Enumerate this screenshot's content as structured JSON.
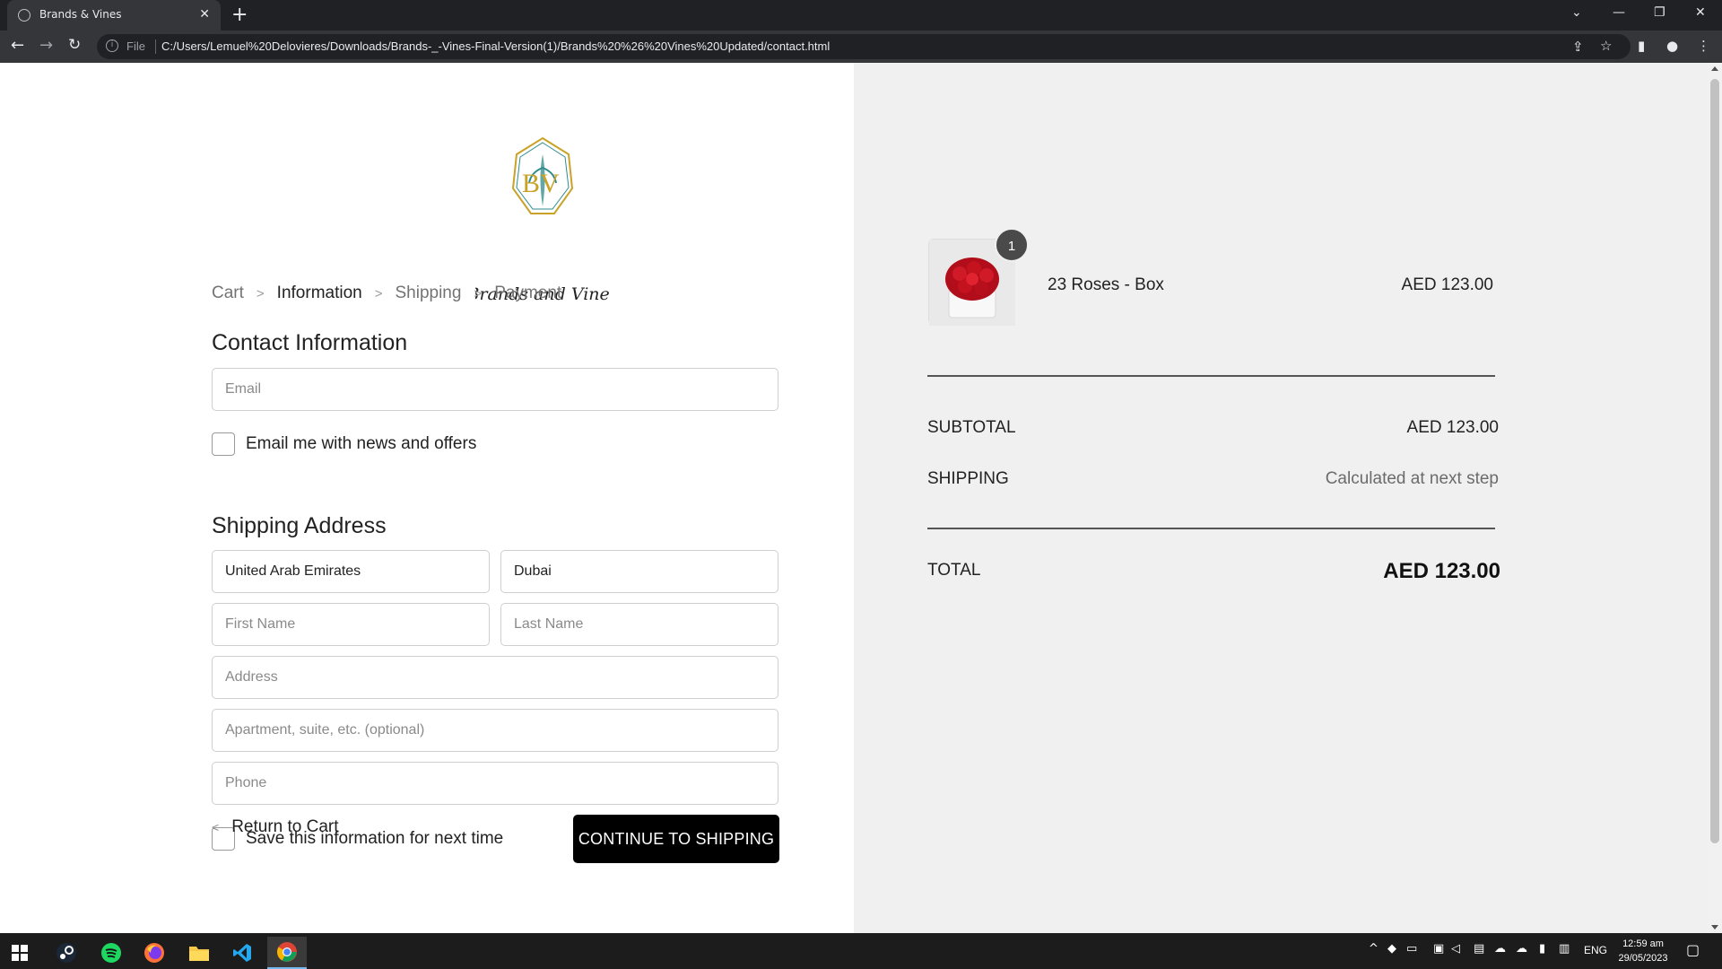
{
  "browser": {
    "tab_title": "Brands & Vines",
    "tab_close": "✕",
    "new_tab": "+",
    "omnibox_scheme": "File",
    "url": "C:/Users/Lemuel%20Delovieres/Downloads/Brands-_-Vines-Final-Version(1)/Brands%20%26%20Vines%20Updated/contact.html"
  },
  "logo": {
    "monogram": "BV",
    "script": "Brands and Vines"
  },
  "breadcrumb": {
    "cart": "Cart",
    "information": "Information",
    "shipping": "Shipping",
    "payment": "Payment",
    "separator": ">"
  },
  "contact": {
    "title": "Contact Information",
    "email_placeholder": "Email",
    "newsletter_label": "Email me with news and offers"
  },
  "shipping_address": {
    "title": "Shipping Address",
    "country_value": "United Arab Emirates",
    "city_value": "Dubai",
    "first_name_placeholder": "First Name",
    "last_name_placeholder": "Last Name",
    "address_placeholder": "Address",
    "apartment_placeholder": "Apartment, suite, etc. (optional)",
    "phone_placeholder": "Phone",
    "save_info_label": "Save this information for next time"
  },
  "actions": {
    "return_chevron": "<",
    "return_label": "Return to Cart",
    "continue_label": "CONTINUE TO SHIPPING"
  },
  "order_summary": {
    "product_name": "23 Roses - Box",
    "product_price": "AED 123.00",
    "quantity": "1",
    "subtotal_label": "SUBTOTAL",
    "subtotal_value": "AED 123.00",
    "shipping_label": "SHIPPING",
    "shipping_value": "Calculated at next step",
    "total_label": "TOTAL",
    "total_value": "AED 123.00"
  },
  "taskbar": {
    "language": "ENG",
    "time": "12:59 am",
    "date": "29/05/2023"
  },
  "colors": {
    "page_bg": "#ffffff",
    "summary_bg": "#f0f0f0",
    "button_bg": "#000000",
    "logo_gold": "#c9a227",
    "logo_teal": "#2e8b8b",
    "rose_red": "#c0111f"
  }
}
